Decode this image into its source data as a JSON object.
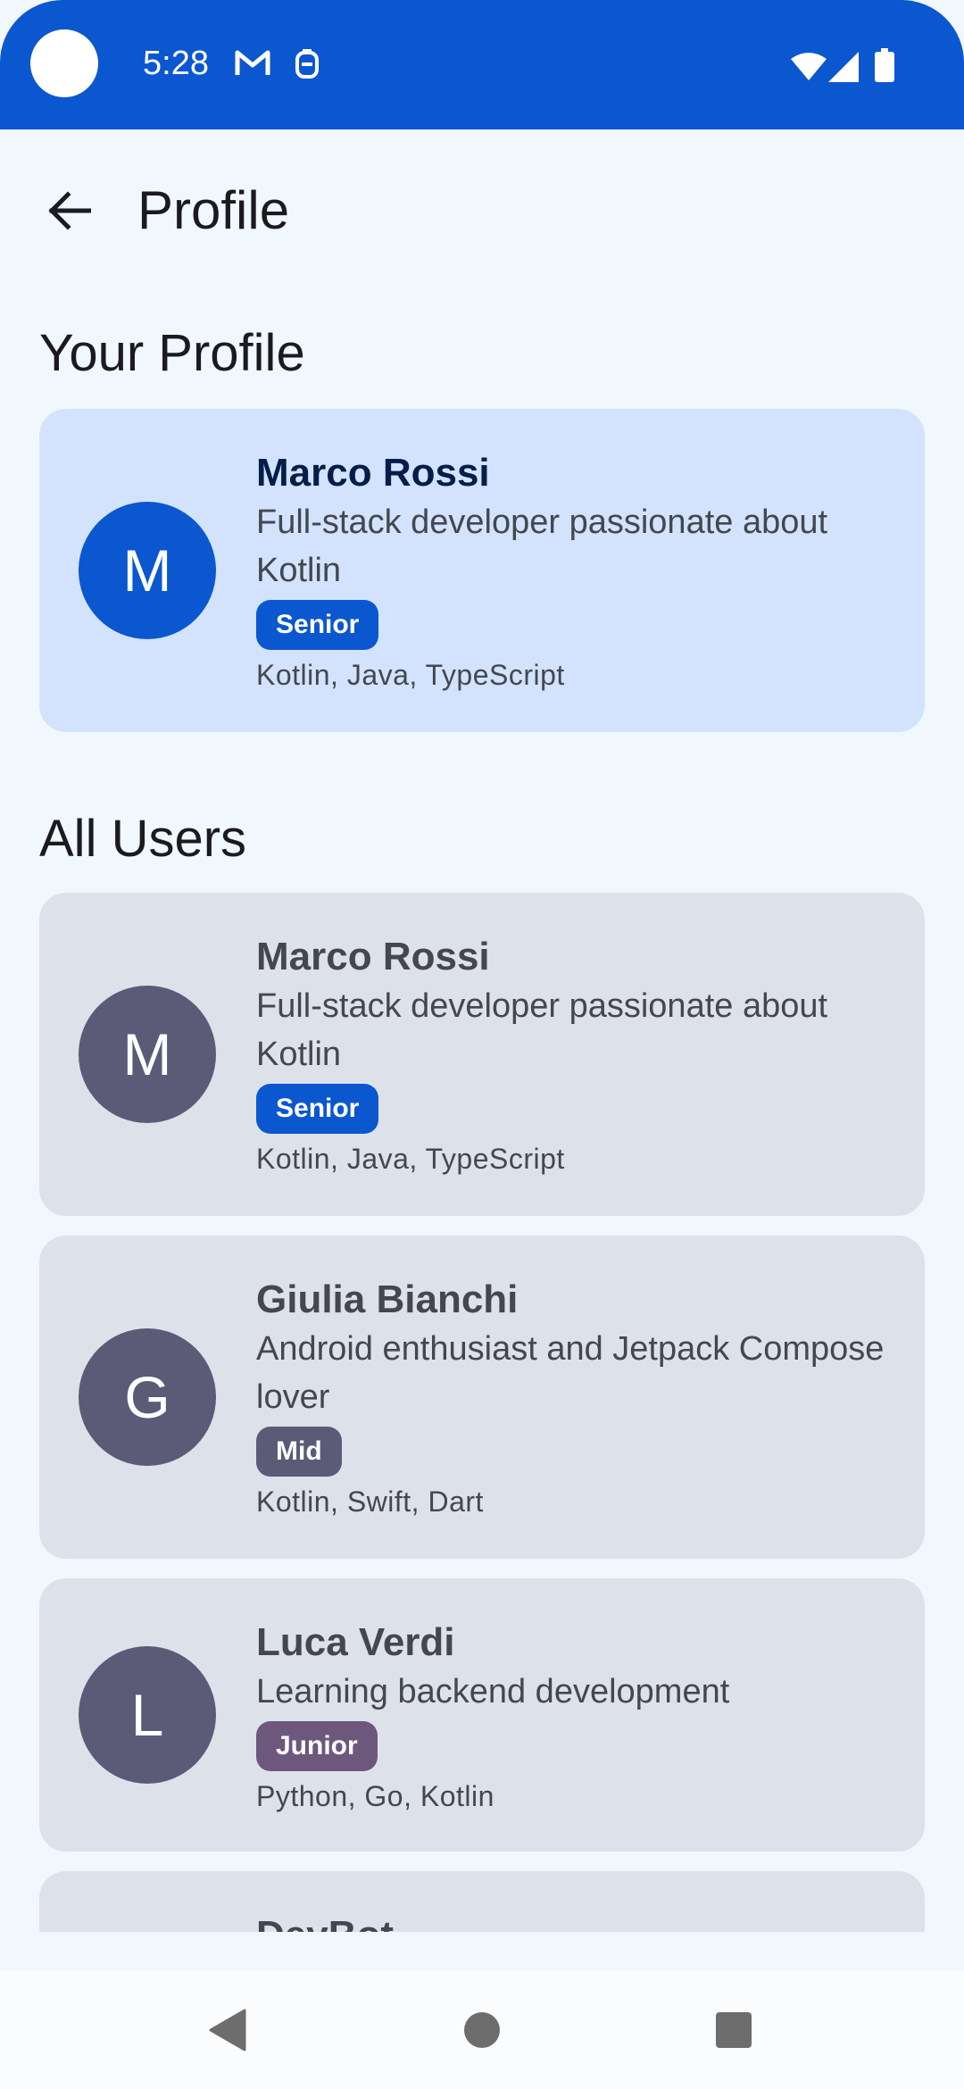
{
  "status_bar": {
    "time": "5:28",
    "icons": [
      "gmail-icon",
      "notification-icon",
      "wifi-icon",
      "signal-icon",
      "battery-icon"
    ]
  },
  "app_bar": {
    "title": "Profile",
    "back_icon": "arrow-back-icon"
  },
  "your_profile": {
    "section_title": "Your Profile",
    "user": {
      "initial": "M",
      "name": "Marco Rossi",
      "bio": "Full-stack developer passionate about Kotlin",
      "level": "Senior",
      "skills": "Kotlin, Java, TypeScript"
    }
  },
  "all_users": {
    "section_title": "All Users",
    "users": [
      {
        "initial": "M",
        "name": "Marco Rossi",
        "bio": "Full-stack developer passionate about Kotlin",
        "level": "Senior",
        "skills": "Kotlin, Java, TypeScript"
      },
      {
        "initial": "G",
        "name": "Giulia Bianchi",
        "bio": "Android enthusiast and Jetpack Compose lover",
        "level": "Mid",
        "skills": "Kotlin, Swift, Dart"
      },
      {
        "initial": "L",
        "name": "Luca Verdi",
        "bio": "Learning backend development",
        "level": "Junior",
        "skills": "Python, Go, Kotlin"
      },
      {
        "name": "DevBot"
      }
    ]
  },
  "colors": {
    "primary": "#0b57d0",
    "background": "#f1f8fd",
    "primary_container": "#d3e3fd",
    "surface_variant": "#dde2ea",
    "avatar_secondary": "#5b5b77",
    "junior_badge": "#6d577d"
  },
  "nav_bar": {
    "icons": [
      "nav-back-icon",
      "nav-home-icon",
      "nav-recents-icon"
    ]
  }
}
